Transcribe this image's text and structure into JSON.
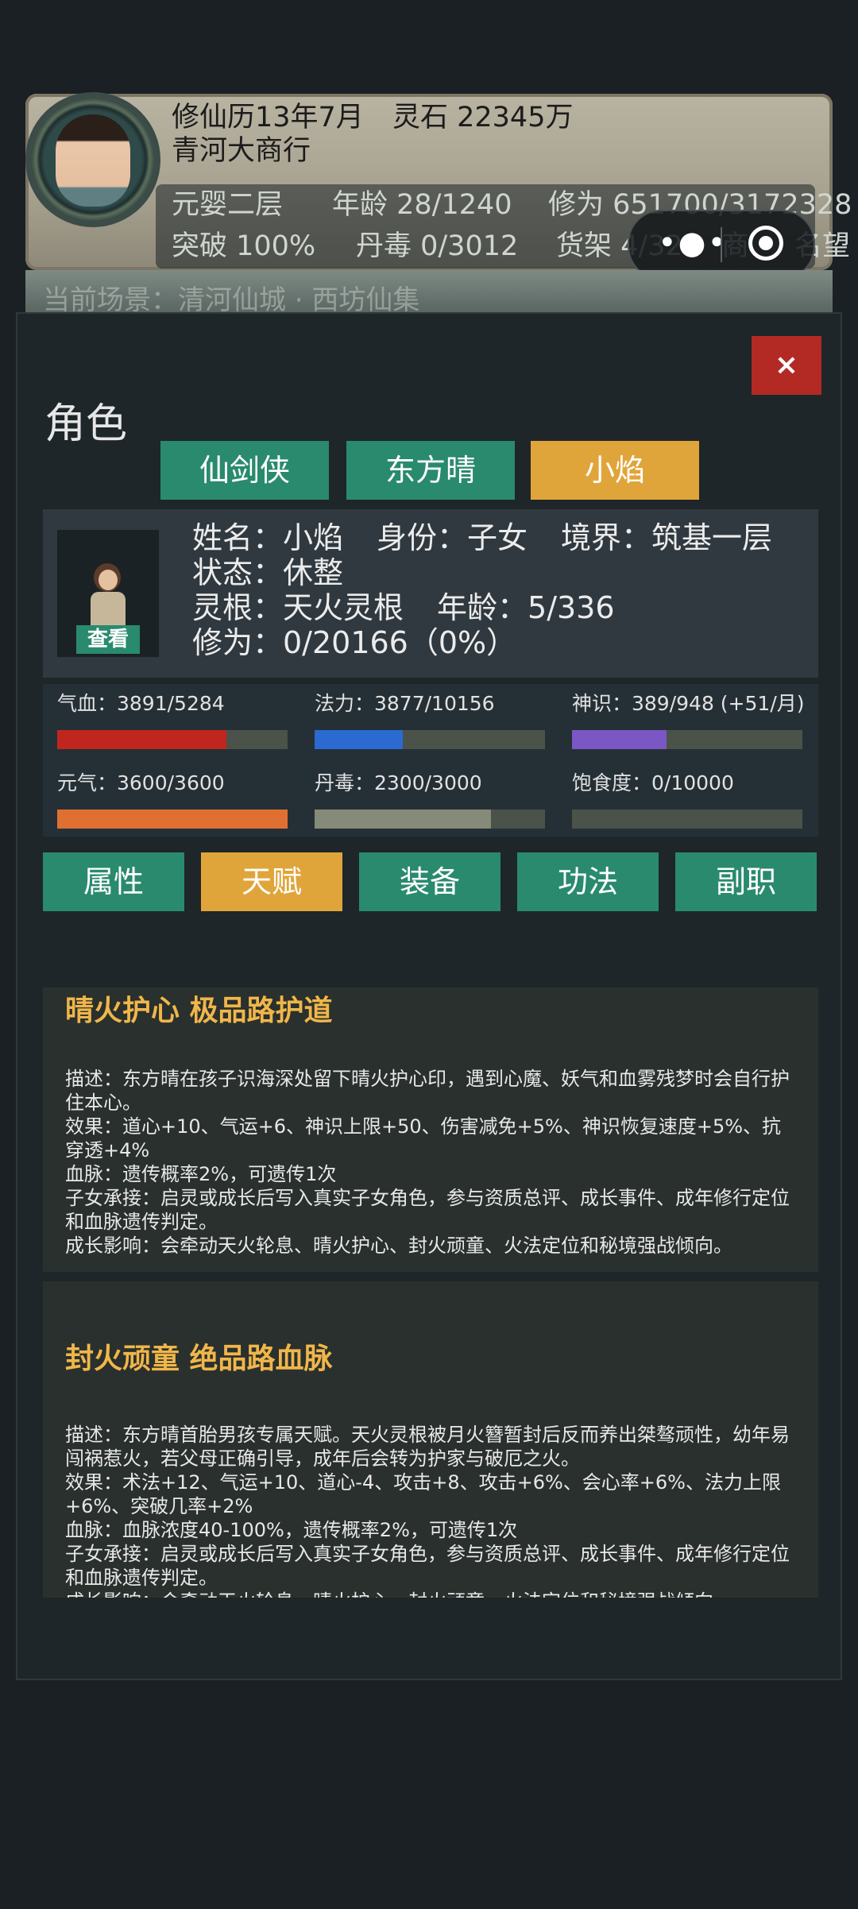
{
  "header": {
    "calendar": "修仙历13年7月",
    "spirit_stones": "灵石 22345万",
    "shop_name": "青河大商行",
    "realm": "元婴二层",
    "age": "年龄 28/1240",
    "cultivation": "修为 651700/3172328",
    "breakthrough": "突破 100%",
    "pill_poison": "丹毒 0/3012",
    "shelf": "货架 4/32",
    "shop_partial": "商",
    "reputation_partial": "名望",
    "scene": "当前场景：清河仙城 · 西坊仙集"
  },
  "modal": {
    "close_label": "×",
    "title": "角色",
    "character_tabs": [
      "仙剑侠",
      "东方晴",
      "小焰"
    ],
    "info": {
      "name": "姓名：小焰",
      "identity": "身份：子女",
      "realm": "境界：筑基一层",
      "status": "状态：休整",
      "root": "灵根：天火灵根",
      "age": "年龄：5/336",
      "cultivation": "修为：0/20166（0%）",
      "view_label": "查看"
    },
    "stats": [
      {
        "label": "气血：3891/5284",
        "ratio": 0.736,
        "color": "#c0261e"
      },
      {
        "label": "法力：3877/10156",
        "ratio": 0.382,
        "color": "#2b6ad0"
      },
      {
        "label": "神识：389/948 (+51/月)",
        "ratio": 0.41,
        "color": "#7a57c4"
      },
      {
        "label": "元气：3600/3600",
        "ratio": 1.0,
        "color": "#e07032"
      },
      {
        "label": "丹毒：2300/3000",
        "ratio": 0.767,
        "color": "#868a78"
      },
      {
        "label": "饱食度：0/10000",
        "ratio": 0.0,
        "color": "#868a78"
      }
    ],
    "sub_tabs": [
      "属性",
      "天赋",
      "装备",
      "功法",
      "副职"
    ],
    "talents": [
      {
        "title": "晴火护心 极品路护道",
        "lines": [
          "描述：东方晴在孩子识海深处留下晴火护心印，遇到心魔、妖气和血雾残梦时会自行护住本心。",
          "效果：道心+10、气运+6、神识上限+50、伤害减免+5%、神识恢复速度+5%、抗穿透+4%",
          "血脉：遗传概率2%，可遗传1次",
          "子女承接：启灵或成长后写入真实子女角色，参与资质总评、成长事件、成年修行定位和血脉遗传判定。",
          "成长影响：会牵动天火轮息、晴火护心、封火顽童、火法定位和秘境强战倾向。"
        ]
      },
      {
        "title": "封火顽童 绝品路血脉",
        "lines": [
          "描述：东方晴首胎男孩专属天赋。天火灵根被月火簪暂封后反而养出桀骜顽性，幼年易闯祸惹火，若父母正确引导，成年后会转为护家与破厄之火。",
          "效果：术法+12、气运+10、道心-4、攻击+8、攻击+6%、会心率+6%、法力上限+6%、突破几率+2%",
          "血脉：血脉浓度40-100%，遗传概率2%，可遗传1次",
          "子女承接：启灵或成长后写入真实子女角色，参与资质总评、成长事件、成年修行定位和血脉遗传判定。",
          "成长影响：会牵动天火轮息、晴火护心、封火顽童、火法定位和秘境强战倾向。"
        ]
      }
    ]
  }
}
